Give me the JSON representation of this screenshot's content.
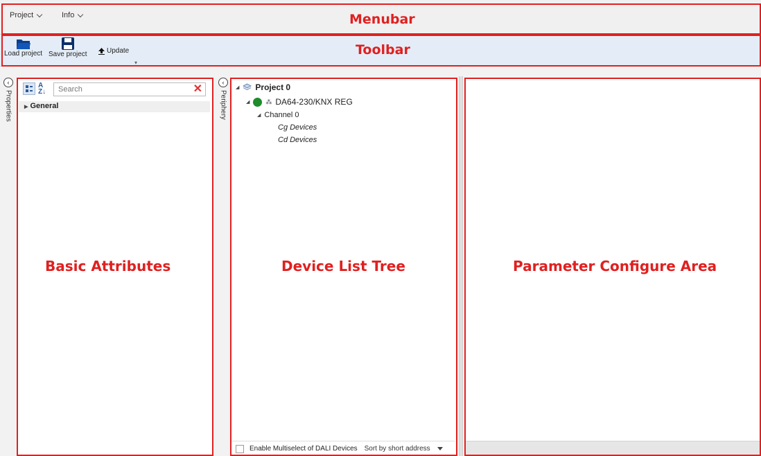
{
  "menubar": {
    "items": [
      {
        "label": "Project"
      },
      {
        "label": "Info"
      }
    ]
  },
  "toolbar": {
    "load_label": "Load project",
    "save_label": "Save project",
    "update_label": "Update"
  },
  "side_tabs": {
    "properties": "Properties",
    "periphery": "Periphery"
  },
  "properties": {
    "search_placeholder": "Search",
    "group_label": "General"
  },
  "tree": {
    "root": "Project 0",
    "device": "DA64-230/KNX REG",
    "channel": "Channel 0",
    "cg": "Cg Devices",
    "cd": "Cd Devices",
    "multiselect_label": "Enable Multiselect of DALI Devices",
    "sort_value": "Sort by short address"
  },
  "annotations": {
    "menubar": "Menubar",
    "toolbar": "Toolbar",
    "basic_attributes": "Basic Attributes",
    "device_tree": "Device List Tree",
    "parameter_area": "Parameter Configure Area"
  },
  "colors": {
    "annotation": "#e02020",
    "toolbar_bg": "#e4edf7",
    "status_green": "#1e8c2a"
  }
}
